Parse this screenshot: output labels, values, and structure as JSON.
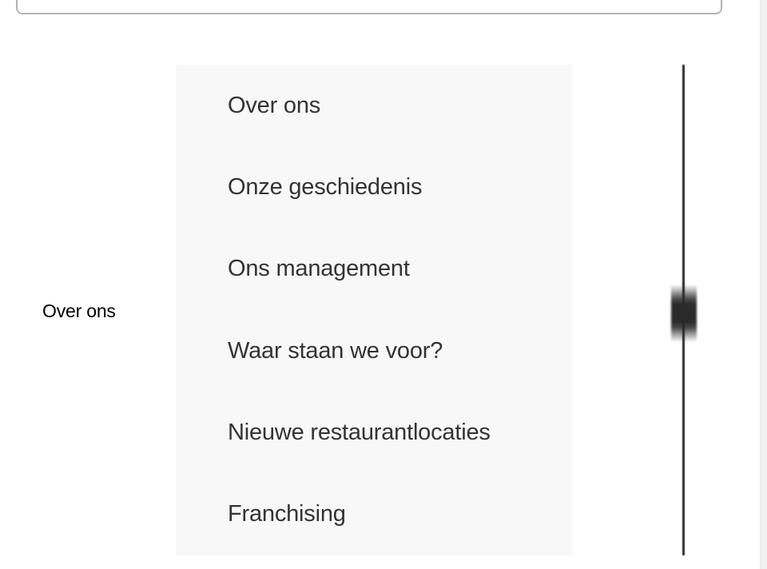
{
  "section": {
    "label": "Over ons"
  },
  "menu": {
    "items": [
      {
        "label": "Over ons"
      },
      {
        "label": "Onze geschiedenis"
      },
      {
        "label": "Ons management"
      },
      {
        "label": "Waar staan we voor?"
      },
      {
        "label": "Nieuwe restaurantlocaties"
      },
      {
        "label": "Franchising"
      }
    ]
  },
  "slider": {
    "position_fraction": 0.5
  },
  "colors": {
    "menu_background": "#f8f8f8",
    "menu_text": "#333333",
    "slider": "#2a2a2a",
    "panel_border": "#b3b3b3"
  }
}
